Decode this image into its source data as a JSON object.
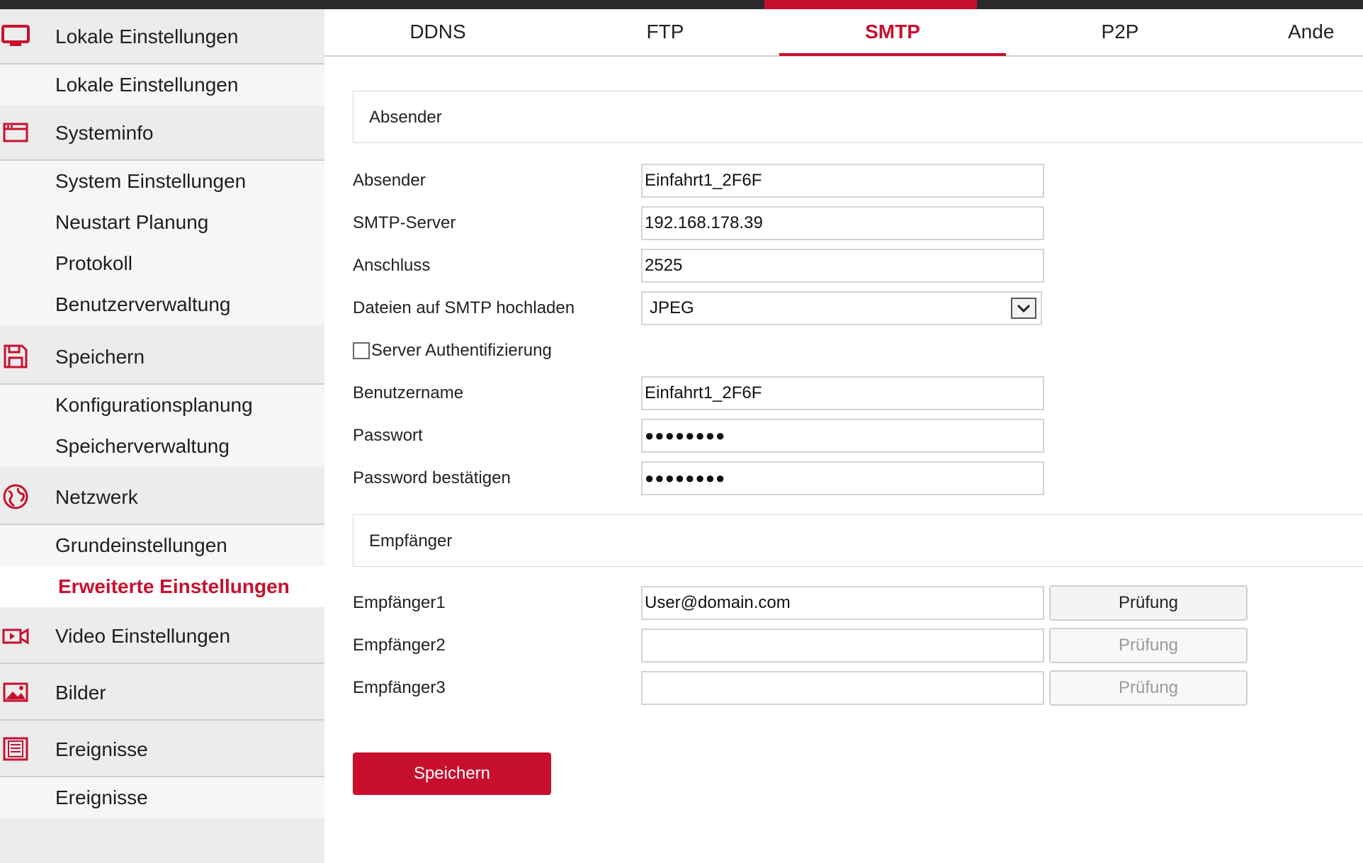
{
  "tabs": [
    {
      "label": "DDNS"
    },
    {
      "label": "FTP"
    },
    {
      "label": "SMTP"
    },
    {
      "label": "P2P"
    },
    {
      "label": "Ande"
    }
  ],
  "active_tab": "SMTP",
  "accent_color": "#c8102e",
  "sidebar": {
    "local_settings": {
      "label": "Lokale Einstellungen",
      "icon": "monitor-icon"
    },
    "local_settings_item": {
      "label": "Lokale Einstellungen"
    },
    "systeminfo": {
      "label": "Systeminfo",
      "icon": "system-window-icon"
    },
    "system_settings": {
      "label": "System Einstellungen"
    },
    "restart_schedule": {
      "label": "Neustart Planung"
    },
    "log": {
      "label": "Protokoll"
    },
    "user_management": {
      "label": "Benutzerverwaltung"
    },
    "storage": {
      "label": "Speichern",
      "icon": "floppy-disk-icon"
    },
    "config_schedule": {
      "label": "Konfigurationsplanung"
    },
    "storage_management": {
      "label": "Speicherverwaltung"
    },
    "network": {
      "label": "Netzwerk",
      "icon": "globe-icon"
    },
    "basic_settings": {
      "label": "Grundeinstellungen"
    },
    "advanced_settings": {
      "label": "Erweiterte Einstellungen"
    },
    "video_settings": {
      "label": "Video Einstellungen",
      "icon": "video-camera-icon"
    },
    "images": {
      "label": "Bilder",
      "icon": "image-icon"
    },
    "events": {
      "label": "Ereignisse",
      "icon": "event-list-icon"
    },
    "events_item": {
      "label": "Ereignisse"
    }
  },
  "sender_section": {
    "title": "Absender"
  },
  "form": {
    "sender": {
      "label": "Absender",
      "value": "Einfahrt1_2F6F"
    },
    "smtp_server": {
      "label": "SMTP-Server",
      "value": "192.168.178.39"
    },
    "port": {
      "label": "Anschluss",
      "value": "2525"
    },
    "upload": {
      "label": "Dateien auf SMTP hochladen",
      "value": "JPEG"
    },
    "auth": {
      "label": "Server Authentifizierung",
      "checked": false
    },
    "username": {
      "label": "Benutzername",
      "value": "Einfahrt1_2F6F"
    },
    "password": {
      "label": "Passwort",
      "value": "●●●●●●●●"
    },
    "password_confirm": {
      "label": "Password bestätigen",
      "value": "●●●●●●●●"
    }
  },
  "recipient_section": {
    "title": "Empfänger"
  },
  "recipients": [
    {
      "label": "Empfänger1",
      "value": "User@domain.com",
      "button": "Prüfung"
    },
    {
      "label": "Empfänger2",
      "value": "",
      "button": "Prüfung"
    },
    {
      "label": "Empfänger3",
      "value": "",
      "button": "Prüfung"
    }
  ],
  "save_label": "Speichern"
}
